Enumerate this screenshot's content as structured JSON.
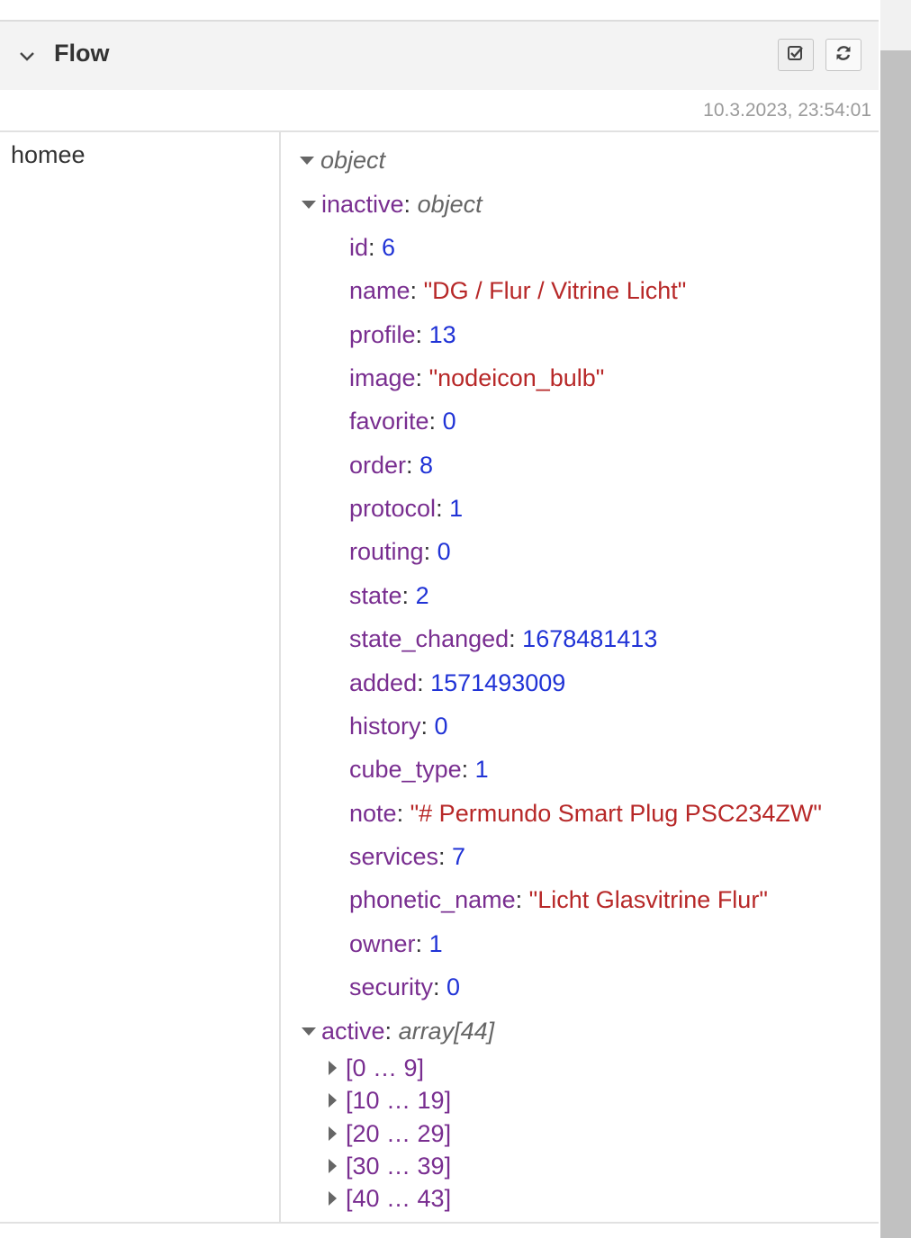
{
  "panel": {
    "title": "Flow",
    "timestamp": "10.3.2023, 23:54:01",
    "topic": "homee"
  },
  "debug": {
    "root_type": "object",
    "inactive": {
      "key": "inactive",
      "type": "object",
      "props": [
        {
          "key": "id",
          "value": "6",
          "kind": "num"
        },
        {
          "key": "name",
          "value": "\"DG / Flur / Vitrine Licht\"",
          "kind": "str"
        },
        {
          "key": "profile",
          "value": "13",
          "kind": "num"
        },
        {
          "key": "image",
          "value": "\"nodeicon_bulb\"",
          "kind": "str"
        },
        {
          "key": "favorite",
          "value": "0",
          "kind": "num"
        },
        {
          "key": "order",
          "value": "8",
          "kind": "num"
        },
        {
          "key": "protocol",
          "value": "1",
          "kind": "num"
        },
        {
          "key": "routing",
          "value": "0",
          "kind": "num"
        },
        {
          "key": "state",
          "value": "2",
          "kind": "num"
        },
        {
          "key": "state_changed",
          "value": "1678481413",
          "kind": "num"
        },
        {
          "key": "added",
          "value": "1571493009",
          "kind": "num"
        },
        {
          "key": "history",
          "value": "0",
          "kind": "num"
        },
        {
          "key": "cube_type",
          "value": "1",
          "kind": "num"
        },
        {
          "key": "note",
          "value": "\"# Permundo Smart Plug PSC234ZW\"",
          "kind": "str"
        },
        {
          "key": "services",
          "value": "7",
          "kind": "num"
        },
        {
          "key": "phonetic_name",
          "value": "\"Licht Glasvitrine Flur\"",
          "kind": "str"
        },
        {
          "key": "owner",
          "value": "1",
          "kind": "num"
        },
        {
          "key": "security",
          "value": "0",
          "kind": "num"
        }
      ]
    },
    "active": {
      "key": "active",
      "type": "array[44]",
      "ranges": [
        "[0 … 9]",
        "[10 … 19]",
        "[20 … 29]",
        "[30 … 39]",
        "[40 … 43]"
      ]
    }
  },
  "icons": {
    "collapse": "chevron-down-icon",
    "select": "check-square-icon",
    "refresh": "refresh-icon"
  },
  "colors": {
    "key": "#792e90",
    "number": "#2033d6",
    "string": "#b72828",
    "type": "#666666"
  }
}
